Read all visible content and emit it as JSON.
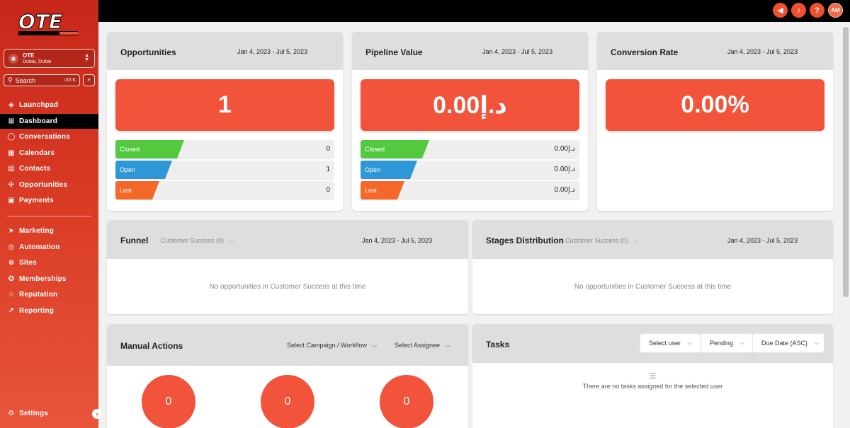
{
  "colors": {
    "accent": "#f2533b",
    "closed": "#52c93f",
    "open": "#2d97d7",
    "lost": "#f6682a",
    "sidebar": "#d63a26"
  },
  "sidebar": {
    "location": {
      "name": "OTE",
      "sub": "Dubai, Dubai"
    },
    "search": {
      "label": "Search",
      "shortcut": "ctrl K"
    },
    "items": [
      {
        "label": "Launchpad",
        "icon": "rocket-icon"
      },
      {
        "label": "Dashboard",
        "icon": "grid-icon"
      },
      {
        "label": "Conversations",
        "icon": "chat-icon"
      },
      {
        "label": "Calendars",
        "icon": "calendar-icon"
      },
      {
        "label": "Contacts",
        "icon": "contacts-icon"
      },
      {
        "label": "Opportunities",
        "icon": "opportunities-icon"
      },
      {
        "label": "Payments",
        "icon": "payments-icon"
      },
      {
        "label": "Marketing",
        "icon": "send-icon"
      },
      {
        "label": "Automation",
        "icon": "automation-icon"
      },
      {
        "label": "Sites",
        "icon": "globe-icon"
      },
      {
        "label": "Memberships",
        "icon": "membership-icon"
      },
      {
        "label": "Reputation",
        "icon": "star-icon"
      },
      {
        "label": "Reporting",
        "icon": "trend-icon"
      }
    ],
    "settings": "Settings"
  },
  "topbar": {
    "avatar": "AM"
  },
  "opportunities": {
    "title": "Opportunities",
    "date": "Jan 4, 2023 - Jul 5, 2023",
    "value": "1",
    "rows": [
      {
        "label": "Closed",
        "value": "0"
      },
      {
        "label": "Open",
        "value": "1"
      },
      {
        "label": "Lost",
        "value": "0"
      }
    ]
  },
  "pipeline": {
    "title": "Pipeline Value",
    "date": "Jan 4, 2023 - Jul 5, 2023",
    "value": "0.00د.إ",
    "rows": [
      {
        "label": "Closed",
        "value": "0.00د.إ"
      },
      {
        "label": "Open",
        "value": "0.00د.إ"
      },
      {
        "label": "Lost",
        "value": "0.00د.إ"
      }
    ]
  },
  "conversion": {
    "title": "Conversion Rate",
    "date": "Jan 4, 2023 - Jul 5, 2023",
    "value": "0.00%"
  },
  "funnel": {
    "title": "Funnel",
    "pipeline": "Customer Success (0)",
    "date": "Jan 4, 2023 - Jul 5, 2023",
    "empty": "No opportunities in Customer Success at this time"
  },
  "stages": {
    "title": "Stages Distribution",
    "pipeline": "Customer Success (0)",
    "date": "Jan 4, 2023 - Jul 5, 2023",
    "empty": "No opportunities in Customer Success at this time"
  },
  "manual": {
    "title": "Manual Actions",
    "campaign": "Select Campaign / Workflow",
    "assignee": "Select Assignee",
    "counts": [
      "0",
      "0",
      "0"
    ]
  },
  "tasks": {
    "title": "Tasks",
    "user": "Select user",
    "status": "Pending",
    "sort": "Due Date (ASC)",
    "empty": "There are no tasks assigned for the selected user"
  }
}
